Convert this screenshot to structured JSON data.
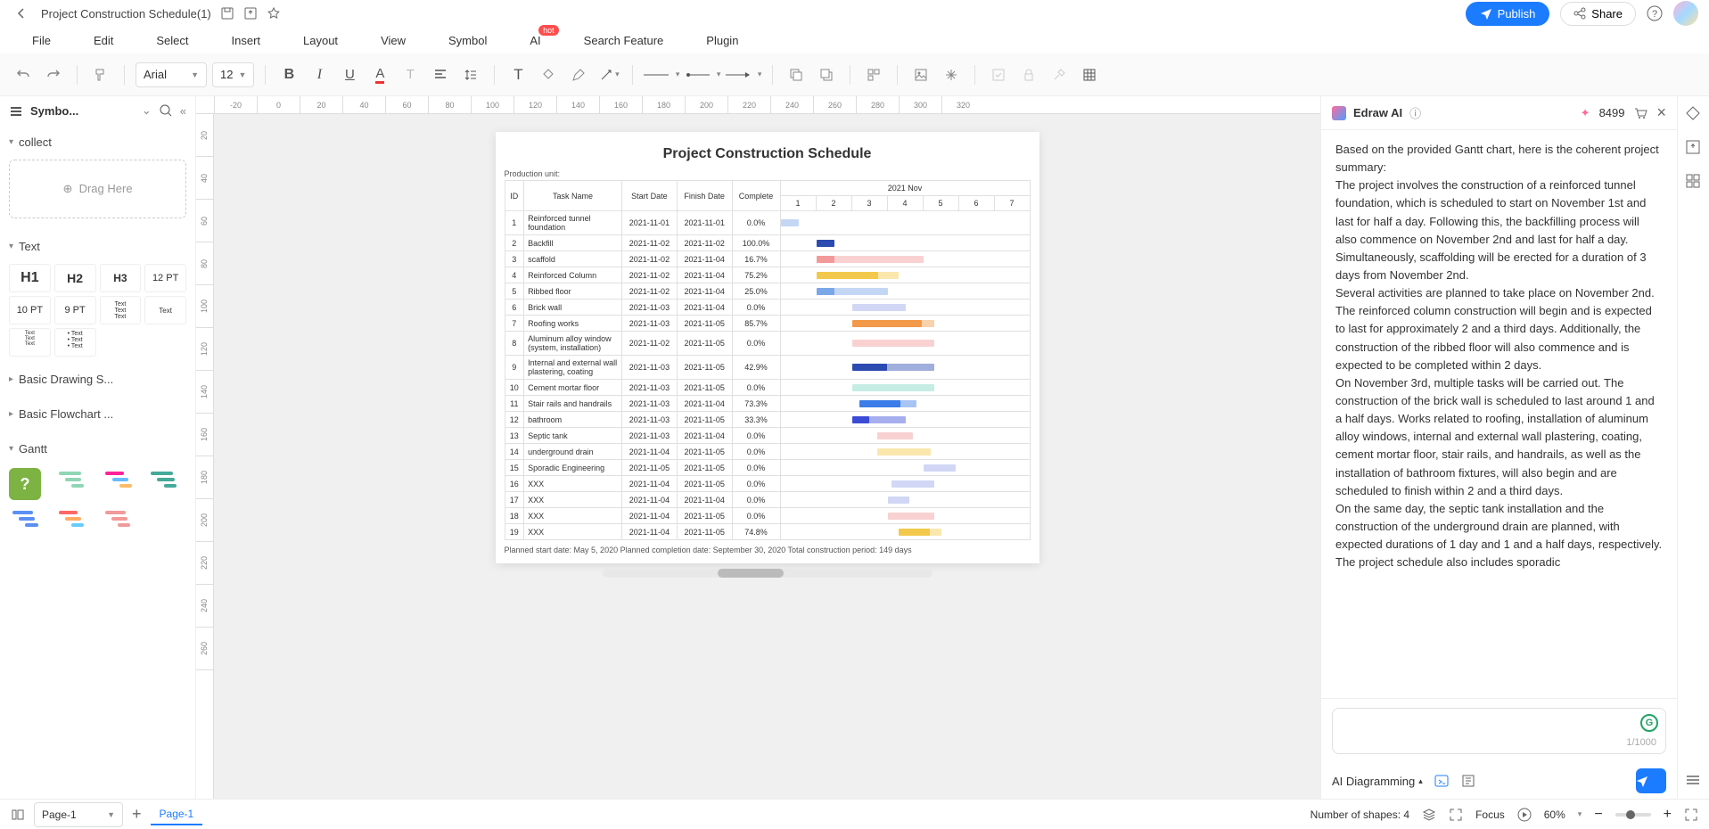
{
  "titlebar": {
    "doc_title": "Project Construction Schedule(1)",
    "publish": "Publish",
    "share": "Share"
  },
  "menubar": [
    "File",
    "Edit",
    "Select",
    "Insert",
    "Layout",
    "View",
    "Symbol",
    "AI",
    "Search Feature",
    "Plugin"
  ],
  "hot_label": "hot",
  "toolbar": {
    "font": "Arial",
    "size": "12"
  },
  "sidebar": {
    "header": "Symbo...",
    "collect": "collect",
    "drag_here": "Drag Here",
    "text": "Text",
    "basic_drawing": "Basic Drawing S...",
    "basic_flowchart": "Basic Flowchart ...",
    "gantt": "Gantt",
    "h1": "H1",
    "h2": "H2",
    "h3": "H3",
    "pt12": "12 PT",
    "pt10": "10 PT",
    "pt9": "9 PT"
  },
  "canvas": {
    "title": "Project Construction Schedule",
    "prod_unit": "Production unit:",
    "month_header": "2021 Nov",
    "cols": {
      "id": "ID",
      "task": "Task Name",
      "start": "Start Date",
      "finish": "Finish Date",
      "complete": "Complete"
    },
    "days": [
      "1",
      "2",
      "3",
      "4",
      "5",
      "6",
      "7"
    ],
    "footer": "Planned start date: May 5, 2020 Planned completion date: September 30, 2020 Total construction period: 149 days"
  },
  "chart_data": {
    "type": "gantt",
    "month": "2021 Nov",
    "days": [
      1,
      2,
      3,
      4,
      5,
      6,
      7
    ],
    "tasks": [
      {
        "id": 1,
        "name": "Reinforced tunnel foundation",
        "start": "2021-11-01",
        "finish": "2021-11-01",
        "complete": "0.0%",
        "bar_start": 1,
        "bar_end": 1.5,
        "color": "#7aa7e8",
        "fill": 0
      },
      {
        "id": 2,
        "name": "Backfill",
        "start": "2021-11-02",
        "finish": "2021-11-02",
        "complete": "100.0%",
        "bar_start": 2,
        "bar_end": 2.5,
        "color": "#2b4bb0",
        "fill": 100
      },
      {
        "id": 3,
        "name": "scaffold",
        "start": "2021-11-02",
        "finish": "2021-11-04",
        "complete": "16.7%",
        "bar_start": 2,
        "bar_end": 5,
        "color": "#f29999",
        "fill": 16.7
      },
      {
        "id": 4,
        "name": "Reinforced Column",
        "start": "2021-11-02",
        "finish": "2021-11-04",
        "complete": "75.2%",
        "bar_start": 2,
        "bar_end": 4.3,
        "color": "#f2c94c",
        "fill": 75.2
      },
      {
        "id": 5,
        "name": "Ribbed floor",
        "start": "2021-11-02",
        "finish": "2021-11-04",
        "complete": "25.0%",
        "bar_start": 2,
        "bar_end": 4,
        "color": "#7aa7e8",
        "fill": 25
      },
      {
        "id": 6,
        "name": "Brick wall",
        "start": "2021-11-03",
        "finish": "2021-11-04",
        "complete": "0.0%",
        "bar_start": 3,
        "bar_end": 4.5,
        "color": "#9aa6e8",
        "fill": 0
      },
      {
        "id": 7,
        "name": "Roofing works",
        "start": "2021-11-03",
        "finish": "2021-11-05",
        "complete": "85.7%",
        "bar_start": 3,
        "bar_end": 5.3,
        "color": "#f2994a",
        "fill": 85.7
      },
      {
        "id": 8,
        "name": "Aluminum alloy window (system, installation)",
        "start": "2021-11-02",
        "finish": "2021-11-05",
        "complete": "0.0%",
        "bar_start": 3,
        "bar_end": 5.3,
        "color": "#f29999",
        "fill": 0
      },
      {
        "id": 9,
        "name": "Internal and external wall plastering, coating",
        "start": "2021-11-03",
        "finish": "2021-11-05",
        "complete": "42.9%",
        "bar_start": 3,
        "bar_end": 5.3,
        "color": "#2b4bb0",
        "fill": 42.9,
        "secondary": "#9aa6e8"
      },
      {
        "id": 10,
        "name": "Cement mortar floor",
        "start": "2021-11-03",
        "finish": "2021-11-05",
        "complete": "0.0%",
        "bar_start": 3,
        "bar_end": 5.3,
        "color": "#7ed6c0",
        "fill": 0
      },
      {
        "id": 11,
        "name": "Stair rails and handrails",
        "start": "2021-11-03",
        "finish": "2021-11-04",
        "complete": "73.3%",
        "bar_start": 3.2,
        "bar_end": 4.8,
        "color": "#3b7de8",
        "fill": 73.3
      },
      {
        "id": 12,
        "name": "bathroom",
        "start": "2021-11-03",
        "finish": "2021-11-05",
        "complete": "33.3%",
        "bar_start": 3,
        "bar_end": 4.5,
        "color": "#3b4bd6",
        "fill": 33.3
      },
      {
        "id": 13,
        "name": "Septic tank",
        "start": "2021-11-03",
        "finish": "2021-11-04",
        "complete": "0.0%",
        "bar_start": 3.7,
        "bar_end": 4.7,
        "color": "#f29999",
        "fill": 0
      },
      {
        "id": 14,
        "name": "underground drain",
        "start": "2021-11-04",
        "finish": "2021-11-05",
        "complete": "0.0%",
        "bar_start": 3.7,
        "bar_end": 5.2,
        "color": "#f2c94c",
        "fill": 0
      },
      {
        "id": 15,
        "name": "Sporadic Engineering",
        "start": "2021-11-05",
        "finish": "2021-11-05",
        "complete": "0.0%",
        "bar_start": 5,
        "bar_end": 5.9,
        "color": "#9aa6e8",
        "fill": 0
      },
      {
        "id": 16,
        "name": "XXX",
        "start": "2021-11-04",
        "finish": "2021-11-05",
        "complete": "0.0%",
        "bar_start": 4.1,
        "bar_end": 5.3,
        "color": "#9aa6e8",
        "fill": 0
      },
      {
        "id": 17,
        "name": "XXX",
        "start": "2021-11-04",
        "finish": "2021-11-04",
        "complete": "0.0%",
        "bar_start": 4,
        "bar_end": 4.6,
        "color": "#9aa6e8",
        "fill": 0
      },
      {
        "id": 18,
        "name": "XXX",
        "start": "2021-11-04",
        "finish": "2021-11-05",
        "complete": "0.0%",
        "bar_start": 4,
        "bar_end": 5.3,
        "color": "#f29999",
        "fill": 0
      },
      {
        "id": 19,
        "name": "XXX",
        "start": "2021-11-04",
        "finish": "2021-11-05",
        "complete": "74.8%",
        "bar_start": 4.3,
        "bar_end": 5.5,
        "color": "#f2c94c",
        "fill": 74.8
      }
    ]
  },
  "ai": {
    "title": "Edraw AI",
    "credits": "8499",
    "body": "Based on the provided Gantt chart, here is the coherent project summary:\nThe project involves the construction of a reinforced tunnel foundation, which is scheduled to start on November 1st and last for half a day. Following this, the backfilling process will also commence on November 2nd and last for half a day. Simultaneously, scaffolding will be erected for a duration of 3 days from November 2nd.\nSeveral activities are planned to take place on November 2nd. The reinforced column construction will begin and is expected to last for approximately 2 and a third days. Additionally, the construction of the ribbed floor will also commence and is expected to be completed within 2 days.\nOn November 3rd, multiple tasks will be carried out. The construction of the brick wall is scheduled to last around 1 and a half days. Works related to roofing, installation of aluminum alloy windows, internal and external wall plastering, coating, cement mortar floor, stair rails, and handrails, as well as the installation of bathroom fixtures, will also begin and are scheduled to finish within 2 and a third days.\nOn the same day, the septic tank installation and the construction of the underground drain are planned, with expected durations of 1 day and 1 and a half days, respectively.\nThe project schedule also includes sporadic",
    "char_count": "1/1000",
    "diag": "AI Diagramming"
  },
  "status": {
    "page_select": "Page-1",
    "page_tab": "Page-1",
    "shapes": "Number of shapes: 4",
    "focus": "Focus",
    "zoom": "60%"
  },
  "ruler_h": [
    "-20",
    "0",
    "20",
    "40",
    "60",
    "80",
    "100",
    "120",
    "140",
    "160",
    "180",
    "200",
    "220",
    "240",
    "260",
    "280",
    "300",
    "320"
  ],
  "ruler_v": [
    "20",
    "40",
    "60",
    "80",
    "100",
    "120",
    "140",
    "160",
    "180",
    "200",
    "220",
    "240",
    "260"
  ]
}
